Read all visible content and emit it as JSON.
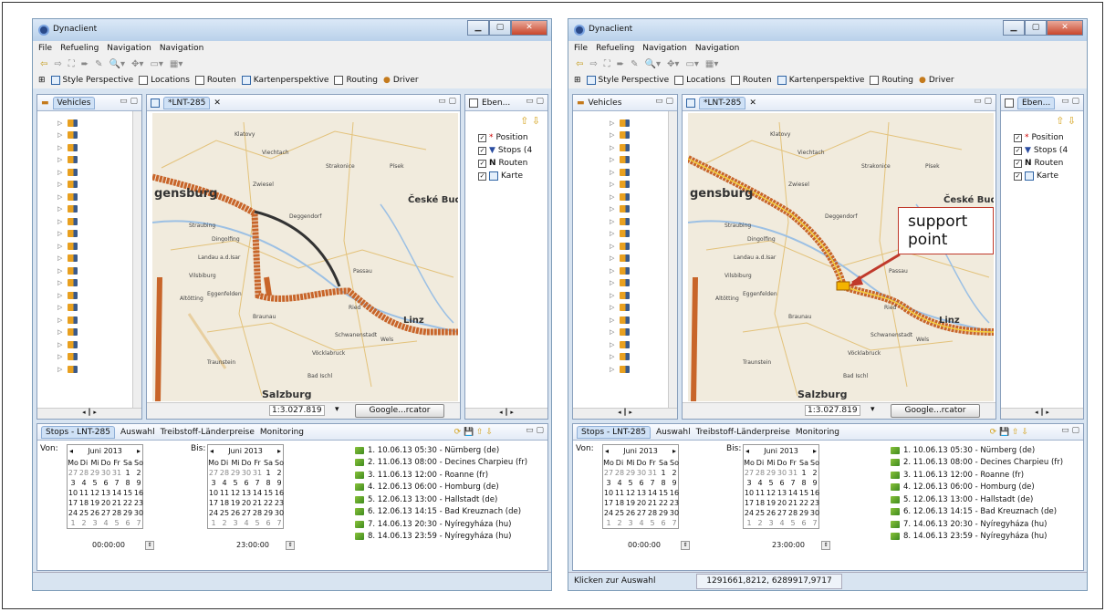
{
  "window_title": "Dynaclient",
  "menu": [
    "File",
    "Refueling",
    "Navigation",
    "Navigation"
  ],
  "perspectives": [
    "Style Perspective",
    "Locations",
    "Routen",
    "Kartenperspektive",
    "Routing",
    "Driver"
  ],
  "vehicles_tab": "Vehicles",
  "map_tab": "*LNT-285",
  "layers_tab_left": "Eben...",
  "layers_tab_right": "Eben...",
  "layers": [
    "Position",
    "Stops (4",
    "Routen",
    "Karte"
  ],
  "layers_right": [
    "Position",
    "Stops (4",
    "Routen",
    "Karte"
  ],
  "scale": "1:3.027.819",
  "projection_button": "Google...rcator",
  "bottom_tabs": [
    "Stops - LNT-285",
    "Auswahl",
    "Treibstoff-Länderpreise",
    "Monitoring"
  ],
  "von_label": "Von:",
  "bis_label": "Bis:",
  "cal_month": "Juni 2013",
  "cal_days": [
    "Mo",
    "Di",
    "Mi",
    "Do",
    "Fr",
    "Sa",
    "So"
  ],
  "cal_rows": [
    [
      "27",
      "28",
      "29",
      "30",
      "31",
      "1",
      "2"
    ],
    [
      "3",
      "4",
      "5",
      "6",
      "7",
      "8",
      "9"
    ],
    [
      "10",
      "11",
      "12",
      "13",
      "14",
      "15",
      "16"
    ],
    [
      "17",
      "18",
      "19",
      "20",
      "21",
      "22",
      "23"
    ],
    [
      "24",
      "25",
      "26",
      "27",
      "28",
      "29",
      "30"
    ],
    [
      "1",
      "2",
      "3",
      "4",
      "5",
      "6",
      "7"
    ]
  ],
  "time_from": "00:00:00",
  "time_to": "23:00:00",
  "stops": [
    "1. 10.06.13 05:30 - Nürnberg (de)",
    "2. 11.06.13 08:00 - Decines Charpieu (fr)",
    "3. 11.06.13 12:00 - Roanne (fr)",
    "4. 12.06.13 06:00 - Homburg (de)",
    "5. 12.06.13 13:00 - Hallstadt (de)",
    "6. 12.06.13 14:15 - Bad Kreuznach (de)",
    "7. 14.06.13 20:30 - Nyíregyháza (hu)",
    "8. 14.06.13 23:59 - Nyíregyháza (hu)"
  ],
  "map_labels": [
    "gensburg",
    "České Bud",
    "Linz",
    "Salzburg",
    "Landau a.d.Isar",
    "Straubing",
    "Deggendorf",
    "Passau",
    "Viechtach",
    "Eggenfelden",
    "Dingolfing",
    "Ried",
    "Wels",
    "Vilsbiburg",
    "Altötting",
    "Braunau",
    "Traunstein",
    "Schwanenstadt",
    "Bad Ischl",
    "Vöcklabruck",
    "Zwiesel",
    "Klatovy",
    "Strakonice",
    "Písek"
  ],
  "status_left": "Klicken zur Auswahl",
  "status_coords": "1291661,8212, 6289917,9717",
  "callout": "support point",
  "colors": {
    "route": "#c8652a",
    "alt_route": "#333333",
    "highlight": "#f4d03f",
    "window_bg": "#d8e4f1"
  }
}
